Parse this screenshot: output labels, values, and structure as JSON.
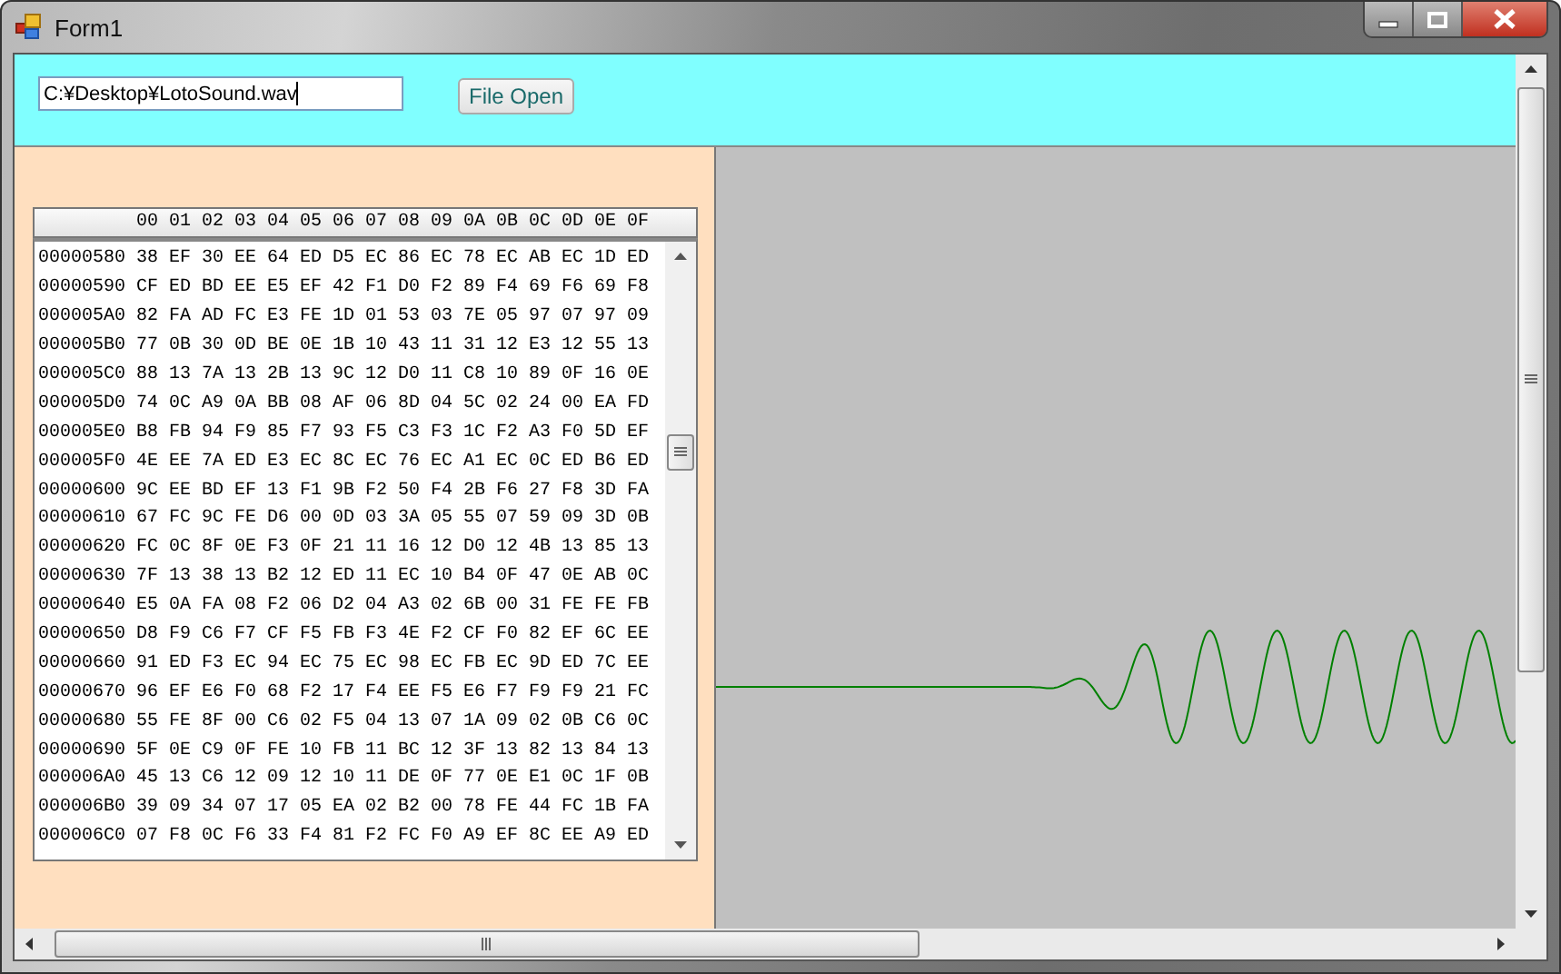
{
  "window": {
    "title": "Form1"
  },
  "file_path": {
    "value": "C:¥Desktop¥LotoSound.wav"
  },
  "open_button": {
    "label": "File Open"
  },
  "hex_view": {
    "header": "00 01 02 03 04 05 06 07 08 09 0A 0B 0C 0D 0E 0F",
    "rows": [
      {
        "address": "00000580",
        "bytes": "38 EF 30 EE 64 ED D5 EC 86 EC 78 EC AB EC 1D ED"
      },
      {
        "address": "00000590",
        "bytes": "CF ED BD EE E5 EF 42 F1 D0 F2 89 F4 69 F6 69 F8"
      },
      {
        "address": "000005A0",
        "bytes": "82 FA AD FC E3 FE 1D 01 53 03 7E 05 97 07 97 09"
      },
      {
        "address": "000005B0",
        "bytes": "77 0B 30 0D BE 0E 1B 10 43 11 31 12 E3 12 55 13"
      },
      {
        "address": "000005C0",
        "bytes": "88 13 7A 13 2B 13 9C 12 D0 11 C8 10 89 0F 16 0E"
      },
      {
        "address": "000005D0",
        "bytes": "74 0C A9 0A BB 08 AF 06 8D 04 5C 02 24 00 EA FD"
      },
      {
        "address": "000005E0",
        "bytes": "B8 FB 94 F9 85 F7 93 F5 C3 F3 1C F2 A3 F0 5D EF"
      },
      {
        "address": "000005F0",
        "bytes": "4E EE 7A ED E3 EC 8C EC 76 EC A1 EC 0C ED B6 ED"
      },
      {
        "address": "00000600",
        "bytes": "9C EE BD EF 13 F1 9B F2 50 F4 2B F6 27 F8 3D FA"
      },
      {
        "address": "00000610",
        "bytes": "67 FC 9C FE D6 00 0D 03 3A 05 55 07 59 09 3D 0B"
      },
      {
        "address": "00000620",
        "bytes": "FC 0C 8F 0E F3 0F 21 11 16 12 D0 12 4B 13 85 13"
      },
      {
        "address": "00000630",
        "bytes": "7F 13 38 13 B2 12 ED 11 EC 10 B4 0F 47 0E AB 0C"
      },
      {
        "address": "00000640",
        "bytes": "E5 0A FA 08 F2 06 D2 04 A3 02 6B 00 31 FE FE FB"
      },
      {
        "address": "00000650",
        "bytes": "D8 F9 C6 F7 CF F5 FB F3 4E F2 CF F0 82 EF 6C EE"
      },
      {
        "address": "00000660",
        "bytes": "91 ED F3 EC 94 EC 75 EC 98 EC FB EC 9D ED 7C EE"
      },
      {
        "address": "00000670",
        "bytes": "96 EF E6 F0 68 F2 17 F4 EE F5 E6 F7 F9 F9 21 FC"
      },
      {
        "address": "00000680",
        "bytes": "55 FE 8F 00 C6 02 F5 04 13 07 1A 09 02 0B C6 0C"
      },
      {
        "address": "00000690",
        "bytes": "5F 0E C9 0F FE 10 FB 11 BC 12 3F 13 82 13 84 13"
      },
      {
        "address": "000006A0",
        "bytes": "45 13 C6 12 09 12 10 11 DE 0F 77 0E E1 0C 1F 0B"
      },
      {
        "address": "000006B0",
        "bytes": "39 09 34 07 17 05 EA 02 B2 00 78 FE 44 FC 1B FA"
      },
      {
        "address": "000006C0",
        "bytes": "07 F8 0C F6 33 F4 81 F2 FC F0 A9 EF 8C EE A9 ED"
      }
    ]
  }
}
